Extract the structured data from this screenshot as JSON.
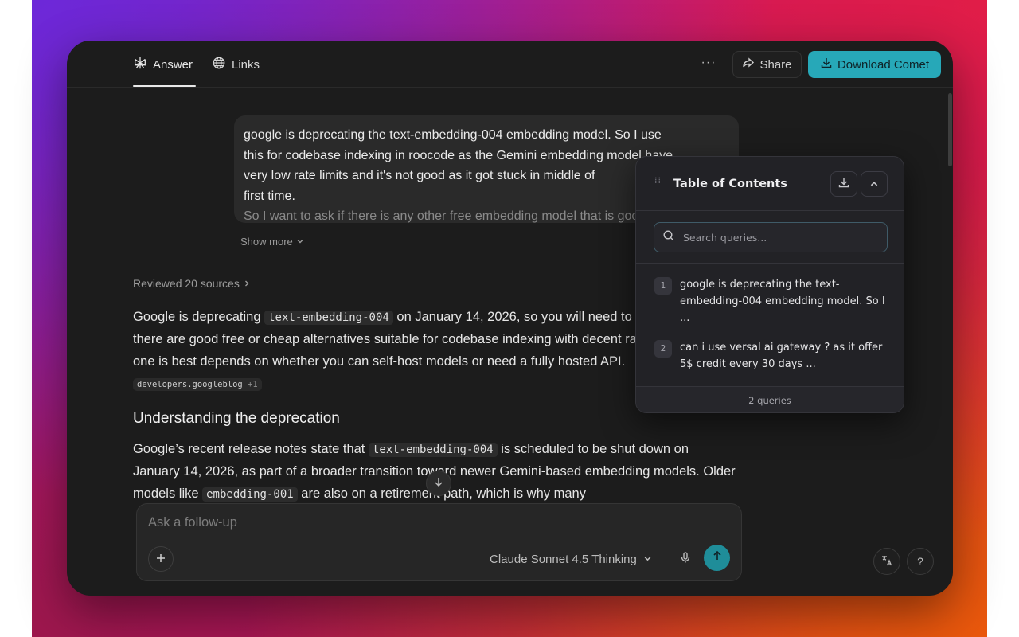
{
  "header": {
    "tabs": [
      {
        "label": "Answer",
        "icon": "perplexity-logo-icon",
        "active": true
      },
      {
        "label": "Links",
        "icon": "globe-icon",
        "active": false
      }
    ],
    "more_label": "···",
    "share_label": "Share",
    "download_label": "Download Comet",
    "accent_color": "#27a8b8"
  },
  "query": {
    "line1": "google is deprecating the text-embedding-004 embedding model. So I use",
    "line2": "this for codebase indexing in roocode as the Gemini embedding model have",
    "line3": "very low rate limits and it's not good as it got stuck in middle of",
    "line4": "first time.",
    "line5": "So I want to ask if there is any other free embedding model that is good",
    "show_more": "Show more"
  },
  "answer": {
    "reviewed": "Reviewed 20 sources",
    "p1_a": "Google is deprecating ",
    "p1_code": "text-embedding-004",
    "p1_b": " on January 14, 2026, so you will need to migrate, but there are good free or cheap alternatives suitable for codebase indexing with decent rate limits. Which one is best depends on whether you can self-host models or need a fully hosted API. ",
    "p1_cite": "developers.googleblog",
    "p1_cite_more": "+1",
    "section_title": "Understanding the deprecation",
    "p2_a": "Google’s recent release notes state that ",
    "p2_code1": "text-embedding-004",
    "p2_b": " is scheduled to be shut down on January 14, 2026, as part of a broader transition toward newer Gemini-based embedding models. Older models like ",
    "p2_code2": "embedding-001",
    "p2_c": " are also on a retirement path, which is why many"
  },
  "composer": {
    "placeholder": "Ask a follow-up",
    "model": "Claude Sonnet 4.5 Thinking"
  },
  "toc": {
    "title": "Table of Contents",
    "search_placeholder": "Search queries...",
    "items": [
      {
        "num": "1",
        "text": "google is deprecating the text-embedding-004 embedding model. So I ..."
      },
      {
        "num": "2",
        "text": "can i use versal ai gateway ? as it offer 5$ credit every 30 days ..."
      }
    ],
    "footer": "2 queries"
  }
}
